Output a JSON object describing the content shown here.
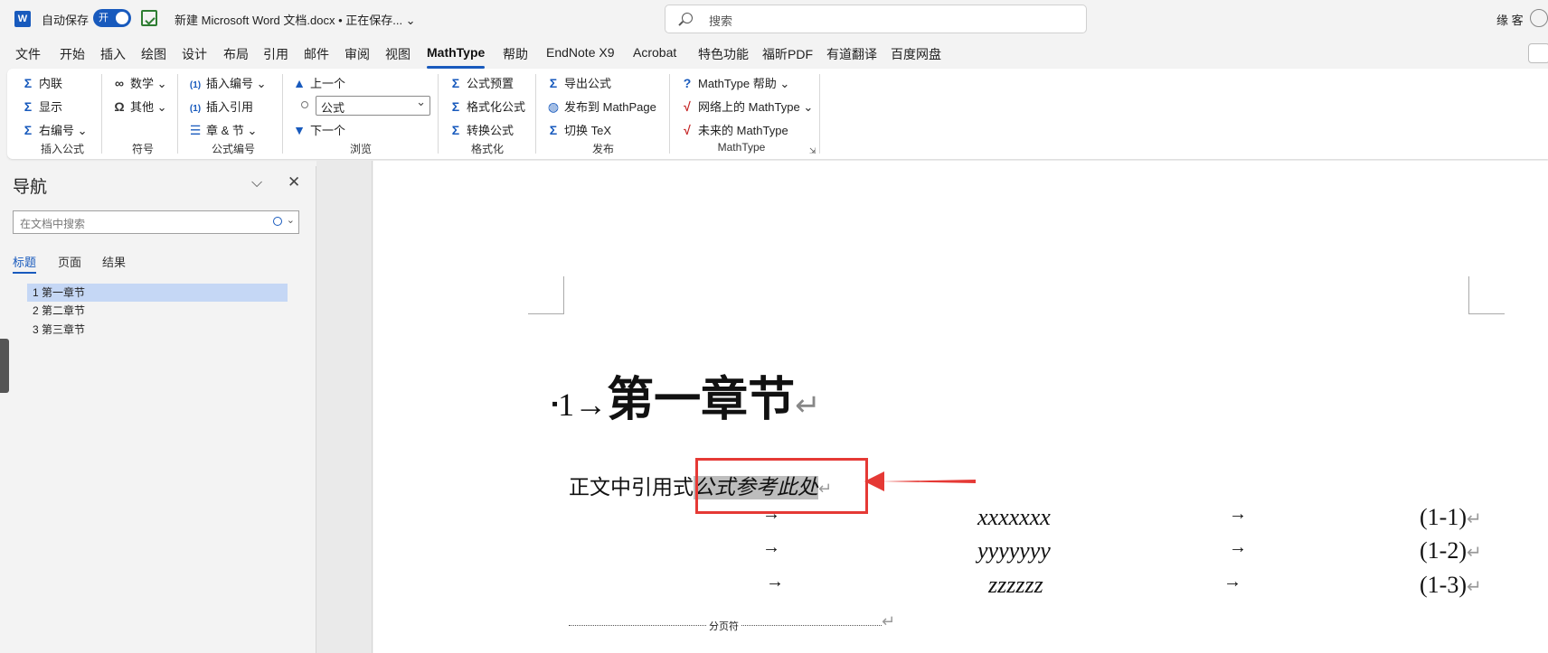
{
  "titlebar": {
    "logo": "W",
    "autosave_label": "自动保存",
    "toggle_label": "开",
    "doc_title": "新建 Microsoft Word 文档.docx • 正在保存... ⌄",
    "search_placeholder": "搜索",
    "user_name": "缘 客"
  },
  "tabs": [
    "文件",
    "开始",
    "插入",
    "绘图",
    "设计",
    "布局",
    "引用",
    "邮件",
    "审阅",
    "视图",
    "MathType",
    "帮助",
    "EndNote X9",
    "Acrobat",
    "特色功能",
    "福昕PDF",
    "有道翻译",
    "百度网盘"
  ],
  "active_tab": "MathType",
  "ribbon": {
    "insert_equation": {
      "items": [
        "内联",
        "显示",
        "右编号"
      ],
      "label": "插入公式"
    },
    "symbols": {
      "items": [
        "数学",
        "其他"
      ],
      "label": "符号"
    },
    "equation_numbers": {
      "items": [
        "插入编号",
        "插入引用",
        "章 & 节"
      ],
      "label": "公式编号"
    },
    "browse": {
      "items": [
        "上一个",
        "下一个"
      ],
      "combo_value": "公式",
      "label": "浏览"
    },
    "format": {
      "items": [
        "公式预置",
        "格式化公式",
        "转换公式"
      ],
      "label": "格式化"
    },
    "publish": {
      "items": [
        "导出公式",
        "发布到 MathPage",
        "切换 TeX"
      ],
      "label": "发布"
    },
    "mathtype": {
      "items": [
        "MathType 帮助",
        "网络上的 MathType",
        "未来的 MathType"
      ],
      "label": "MathType"
    }
  },
  "nav": {
    "title": "导航",
    "search_placeholder": "在文档中搜索",
    "tabs": [
      "标题",
      "页面",
      "结果"
    ],
    "headings": [
      "1 第一章节",
      "2 第二章节",
      "3 第三章节"
    ]
  },
  "document": {
    "heading_num": "1→",
    "heading_text": "第一章节",
    "pilcrow": "↵",
    "para_text": "正文中引用式",
    "para_ref": "公式参考此处",
    "equations": [
      {
        "tab1": "→",
        "expr": "xxxxxxx",
        "tab2": "→",
        "num": "(1-1)"
      },
      {
        "tab1": "→",
        "expr": "yyyyyyy",
        "tab2": "→",
        "num": "(1-2)"
      },
      {
        "tab1": "→",
        "expr": "zzzzzz",
        "tab2": "→",
        "num": "(1-3)"
      }
    ],
    "page_break": "分页符"
  }
}
